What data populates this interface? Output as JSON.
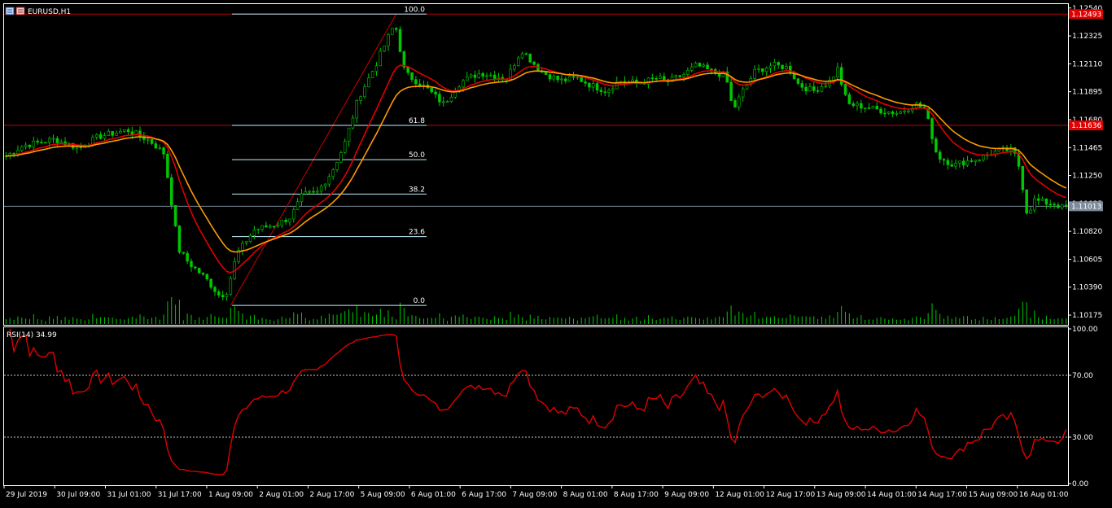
{
  "window": {
    "title": "EURUSD,H1",
    "icon_name": "chart-window-icon"
  },
  "indicator": {
    "label": "RSI(14) 34.99"
  },
  "colors": {
    "background": "#000000",
    "grid_border": "#FFFFFF",
    "bull_candle": "#00C800",
    "volume": "#00C800",
    "ma_fast": "#E00000",
    "ma_slow": "#FF9900",
    "rsi_line": "#E00000",
    "fib_lines": "#BFEFFF",
    "hline": "#C80000",
    "bid_line": "#7D8A9A",
    "axis_text": "#FFFFFF",
    "label_red_bg": "#E00000",
    "label_grey_bg": "#7D8A9A"
  },
  "chart_data": [
    {
      "type": "candlestick",
      "title": "EURUSD,H1",
      "price_axis_ticks": [
        "1.12540",
        "1.12325",
        "1.12110",
        "1.11895",
        "1.11680",
        "1.11465",
        "1.11250",
        "1.11035",
        "1.10820",
        "1.10605",
        "1.10390",
        "1.10175"
      ],
      "price_axis_values": [
        1.1254,
        1.12325,
        1.1211,
        1.11895,
        1.1168,
        1.11465,
        1.1125,
        1.11035,
        1.1082,
        1.10605,
        1.1039,
        1.10175
      ],
      "ylim": [
        1.101,
        1.1257
      ],
      "time_axis_labels": [
        "29 Jul 2019",
        "30 Jul 09:00",
        "31 Jul 01:00",
        "31 Jul 17:00",
        "1 Aug 09:00",
        "2 Aug 01:00",
        "2 Aug 17:00",
        "5 Aug 09:00",
        "6 Aug 01:00",
        "6 Aug 17:00",
        "7 Aug 09:00",
        "8 Aug 01:00",
        "8 Aug 17:00",
        "9 Aug 09:00",
        "12 Aug 01:00",
        "12 Aug 17:00",
        "13 Aug 09:00",
        "14 Aug 01:00",
        "14 Aug 17:00",
        "15 Aug 09:00",
        "16 Aug 01:00"
      ],
      "price_path_keypoints": [
        [
          0,
          1.114
        ],
        [
          14,
          1.1148
        ],
        [
          40,
          1.1153
        ],
        [
          60,
          1.1146
        ],
        [
          76,
          1.1155
        ],
        [
          100,
          1.116
        ],
        [
          118,
          1.1152
        ],
        [
          130,
          1.1142
        ],
        [
          136,
          1.1105
        ],
        [
          142,
          1.1068
        ],
        [
          150,
          1.1058
        ],
        [
          164,
          1.1046
        ],
        [
          176,
          1.1032
        ],
        [
          182,
          1.1036
        ],
        [
          190,
          1.1065
        ],
        [
          204,
          1.1083
        ],
        [
          224,
          1.1088
        ],
        [
          234,
          1.1093
        ],
        [
          244,
          1.111
        ],
        [
          256,
          1.1112
        ],
        [
          268,
          1.1128
        ],
        [
          278,
          1.1148
        ],
        [
          290,
          1.1185
        ],
        [
          304,
          1.121
        ],
        [
          316,
          1.1235
        ],
        [
          320,
          1.1242
        ],
        [
          328,
          1.1204
        ],
        [
          346,
          1.1192
        ],
        [
          360,
          1.118
        ],
        [
          374,
          1.1197
        ],
        [
          390,
          1.1204
        ],
        [
          412,
          1.12
        ],
        [
          424,
          1.1222
        ],
        [
          440,
          1.1205
        ],
        [
          456,
          1.1198
        ],
        [
          470,
          1.12
        ],
        [
          480,
          1.1195
        ],
        [
          494,
          1.119
        ],
        [
          504,
          1.1198
        ],
        [
          520,
          1.1196
        ],
        [
          536,
          1.12
        ],
        [
          544,
          1.1197
        ],
        [
          558,
          1.1203
        ],
        [
          568,
          1.121
        ],
        [
          580,
          1.1205
        ],
        [
          592,
          1.1202
        ],
        [
          598,
          1.1175
        ],
        [
          606,
          1.119
        ],
        [
          616,
          1.1205
        ],
        [
          630,
          1.121
        ],
        [
          644,
          1.1208
        ],
        [
          652,
          1.1195
        ],
        [
          664,
          1.119
        ],
        [
          678,
          1.1198
        ],
        [
          684,
          1.1207
        ],
        [
          692,
          1.118
        ],
        [
          706,
          1.1178
        ],
        [
          720,
          1.1175
        ],
        [
          734,
          1.1173
        ],
        [
          748,
          1.118
        ],
        [
          756,
          1.1176
        ],
        [
          766,
          1.114
        ],
        [
          780,
          1.1133
        ],
        [
          790,
          1.1136
        ],
        [
          800,
          1.1138
        ],
        [
          812,
          1.1143
        ],
        [
          826,
          1.1145
        ],
        [
          832,
          1.1138
        ],
        [
          836,
          1.1118
        ],
        [
          840,
          1.1095
        ],
        [
          846,
          1.1106
        ],
        [
          856,
          1.1104
        ],
        [
          864,
          1.1103
        ],
        [
          868,
          1.11
        ],
        [
          872,
          1.1101
        ]
      ],
      "hlines": [
        {
          "value": 1.12493,
          "label": "1.12493"
        },
        {
          "value": 1.11636,
          "label": "1.11636"
        }
      ],
      "bid_line": {
        "value": 1.11013,
        "label": "1.11013"
      },
      "fibonacci": {
        "high": 1.12493,
        "low": 1.1025,
        "levels": [
          {
            "ratio": 1.0,
            "label": "100.0"
          },
          {
            "ratio": 0.618,
            "label": "61.8"
          },
          {
            "ratio": 0.5,
            "label": "50.0"
          },
          {
            "ratio": 0.382,
            "label": "38.2"
          },
          {
            "ratio": 0.236,
            "label": "23.6"
          },
          {
            "ratio": 0.0,
            "label": "0.0"
          }
        ]
      },
      "moving_averages": [
        {
          "period": 12
        },
        {
          "period": 20
        }
      ],
      "grid": false
    },
    {
      "type": "line",
      "title": "RSI(14) 34.99",
      "ylim": [
        0,
        100
      ],
      "ticks": [
        "100.00",
        "70.00",
        "30.00",
        "0.00"
      ],
      "tick_values": [
        100,
        70,
        30,
        0
      ],
      "levels": [
        70,
        30
      ],
      "last_value": 34.99,
      "rsi_period": 14,
      "grid": false
    }
  ]
}
